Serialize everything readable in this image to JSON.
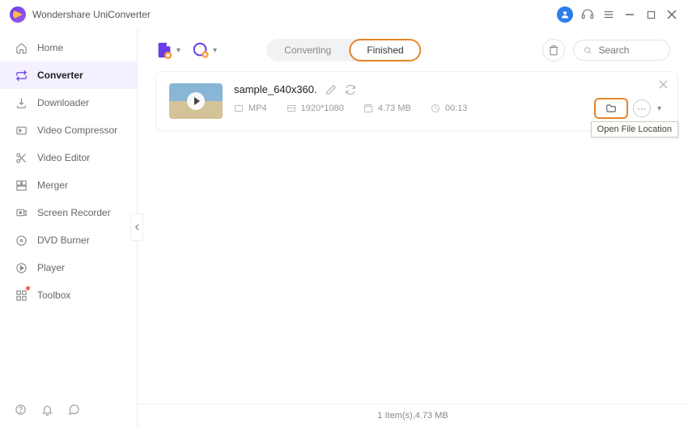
{
  "app": {
    "title": "Wondershare UniConverter"
  },
  "sidebar": {
    "items": [
      {
        "label": "Home"
      },
      {
        "label": "Converter"
      },
      {
        "label": "Downloader"
      },
      {
        "label": "Video Compressor"
      },
      {
        "label": "Video Editor"
      },
      {
        "label": "Merger"
      },
      {
        "label": "Screen Recorder"
      },
      {
        "label": "DVD Burner"
      },
      {
        "label": "Player"
      },
      {
        "label": "Toolbox"
      }
    ]
  },
  "toolbar": {
    "tabs": {
      "converting": "Converting",
      "finished": "Finished"
    },
    "search_placeholder": "Search"
  },
  "file": {
    "name": "sample_640x360.",
    "format": "MP4",
    "resolution": "1920*1080",
    "size": "4.73 MB",
    "duration": "00:13"
  },
  "tooltip": {
    "open_location": "Open File Location"
  },
  "status": {
    "text": "1 Item(s),4.73 MB"
  }
}
